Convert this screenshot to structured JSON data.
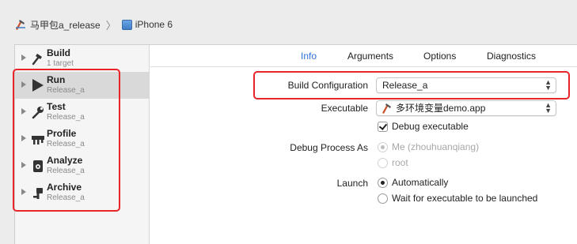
{
  "breadcrumb": {
    "scheme": "马甲包a_release",
    "separator": "〉",
    "device": "iPhone 6"
  },
  "sidebar": {
    "items": [
      {
        "title": "Build",
        "subtitle": "1 target"
      },
      {
        "title": "Run",
        "subtitle": "Release_a"
      },
      {
        "title": "Test",
        "subtitle": "Release_a"
      },
      {
        "title": "Profile",
        "subtitle": "Release_a"
      },
      {
        "title": "Analyze",
        "subtitle": "Release_a"
      },
      {
        "title": "Archive",
        "subtitle": "Release_a"
      }
    ]
  },
  "tabs": [
    "Info",
    "Arguments",
    "Options",
    "Diagnostics"
  ],
  "form": {
    "build_config_label": "Build Configuration",
    "build_config_value": "Release_a",
    "executable_label": "Executable",
    "executable_value": "多环境变量demo.app",
    "debug_exec_label": "Debug executable",
    "debug_process_label": "Debug Process As",
    "debug_process_options": [
      "Me (zhouhuanqiang)",
      "root"
    ],
    "launch_label": "Launch",
    "launch_options": [
      "Automatically",
      "Wait for executable to be launched"
    ]
  },
  "colors": {
    "accent": "#2d6fd6",
    "highlight": "#e8262a",
    "selected_row": "#d9d9d9"
  }
}
